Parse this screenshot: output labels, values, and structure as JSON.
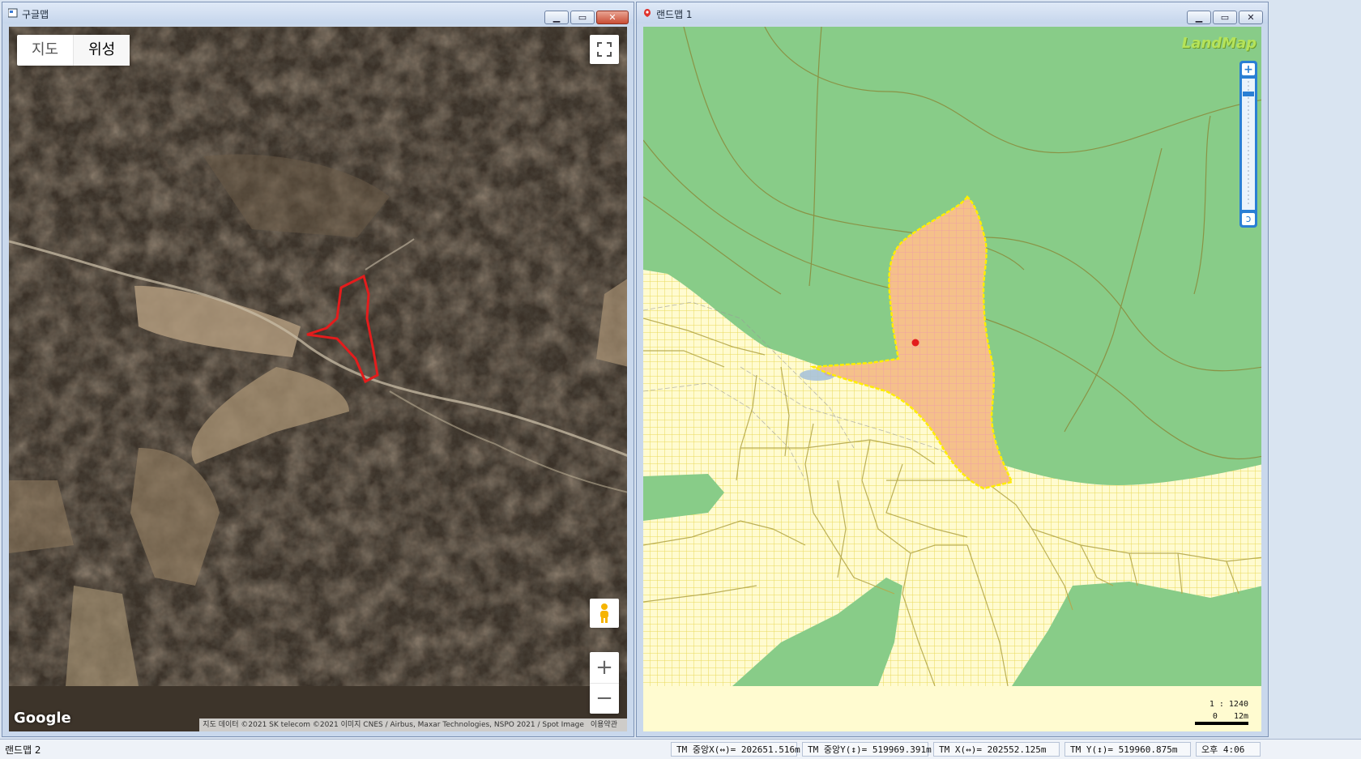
{
  "left_window": {
    "title": "구글맵",
    "map_types": [
      "지도",
      "위성"
    ],
    "selected_map_type": "위성",
    "logo": "Google",
    "attribution": "지도 데이터 ©2021 SK telecom ©2021 이미지 CNES / Airbus, Maxar Technologies, NSPO 2021 / Spot Image",
    "terms": "이용약관",
    "zoom_in": "+",
    "zoom_out": "−"
  },
  "right_window": {
    "title": "랜드맵 1",
    "logo": "LandMap",
    "scale_ratio": "1 : 1240",
    "scale_zero": "0",
    "scale_distance": "12m"
  },
  "status": {
    "left": "랜드맵 2",
    "tm_center_x": "TM 중앙X(↔)= 202651.516m",
    "tm_center_y": "TM 중앙Y(↕)= 519969.391m",
    "tm_x": "TM X(↔)= 202552.125m",
    "tm_y": "TM Y(↕)= 519960.875m",
    "time": "오후 4:06"
  },
  "colors": {
    "forest_green": "#88cc88",
    "farmland_yellow": "#fffbd0",
    "parcel_orange": "#f5c08a",
    "parcel_outline": "#ffee00",
    "selection_red": "#e31c1c"
  }
}
